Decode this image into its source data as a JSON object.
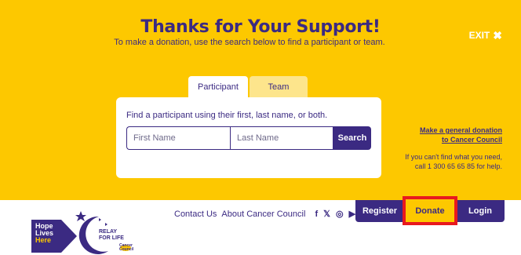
{
  "overlay": {
    "title": "Thanks for Your Support!",
    "subtitle": "To make a donation, use the search below to find a participant or team.",
    "exit_label": "EXIT",
    "tabs": [
      {
        "label": "Participant",
        "active": true
      },
      {
        "label": "Team",
        "active": false
      }
    ],
    "search": {
      "instruction": "Find a participant using their first, last name, or both.",
      "first_placeholder": "First Name",
      "last_placeholder": "Last Name",
      "button_label": "Search"
    },
    "general_donation_line1": "Make a general donation",
    "general_donation_line2": "to Cancer Council",
    "help_line1": "If you can't find what you need,",
    "help_line2": "call 1 300 65 65 85 for help."
  },
  "footer": {
    "links": [
      "Contact Us",
      "About Cancer Council"
    ],
    "social_icons": [
      "facebook-icon",
      "twitter-icon",
      "instagram-icon",
      "youtube-icon"
    ],
    "social_glyphs": [
      "f",
      "𝕏",
      "◎",
      "▶"
    ],
    "nav": {
      "register": "Register",
      "donate": "Donate",
      "login": "Login"
    },
    "hope_logo": [
      "Hope",
      "Lives",
      "Here"
    ],
    "relay_logo": [
      "RELAY",
      "FOR LIFE"
    ],
    "cc_logo": [
      "Cancer",
      "Council"
    ]
  },
  "colors": {
    "brand_purple": "#3b2a82",
    "brand_yellow": "#fdc800",
    "highlight_red": "#e8191e"
  }
}
